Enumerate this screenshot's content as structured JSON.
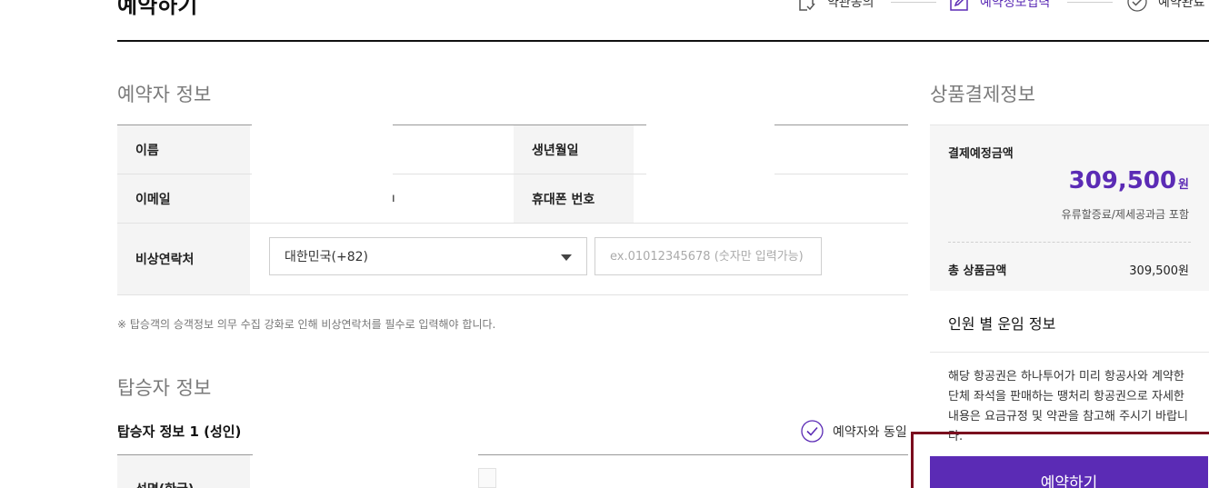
{
  "header": {
    "title": "예약하기",
    "steps": [
      {
        "label": "약관동의",
        "icon": "document-check-icon",
        "active": false
      },
      {
        "label": "예약정보입력",
        "icon": "edit-icon",
        "active": true
      },
      {
        "label": "예약완료",
        "icon": "check-circle-icon",
        "active": false
      }
    ]
  },
  "booker": {
    "section_title": "예약자 정보",
    "name_label": "이름",
    "birth_label": "생년월일",
    "email_label": "이메일",
    "email_value_partial": "ı",
    "mobile_label": "휴대폰 번호",
    "emergency_label": "비상연락처",
    "country_select_value": "대한민국(+82)",
    "phone_placeholder": "ex.01012345678 (숫자만 입력가능)",
    "notice": "※ 탑승객의 승객정보 의무 수집 강화로 인해 비상연락처를 필수로 입력해야 합니다."
  },
  "passenger": {
    "section_title": "탑승자 정보",
    "subtitle": "탑승자 정보 1 (성인)",
    "same_as_booker": "예약자와 동일",
    "name_kr_label": "성명(한글)"
  },
  "payment": {
    "section_title": "상품결제정보",
    "expected_label": "결제예정금액",
    "expected_amount": "309,500",
    "currency_unit": "원",
    "note": "유류할증료/제세공과금 포함",
    "total_label": "총 상품금액",
    "total_value": "309,500원",
    "fare_title": "인원 별 운임 정보",
    "fare_desc": "해당 항공권은 하나투어가 미리 항공사와 계약한 단체 좌석을 판매하는 땡처리 항공권으로 자세한 내용은 요금규정 및 약관을 참고해 주시기 바랍니다.",
    "book_button": "예약하기"
  },
  "colors": {
    "accent": "#5b2bb5",
    "focus_outline": "#7a0c1e"
  }
}
